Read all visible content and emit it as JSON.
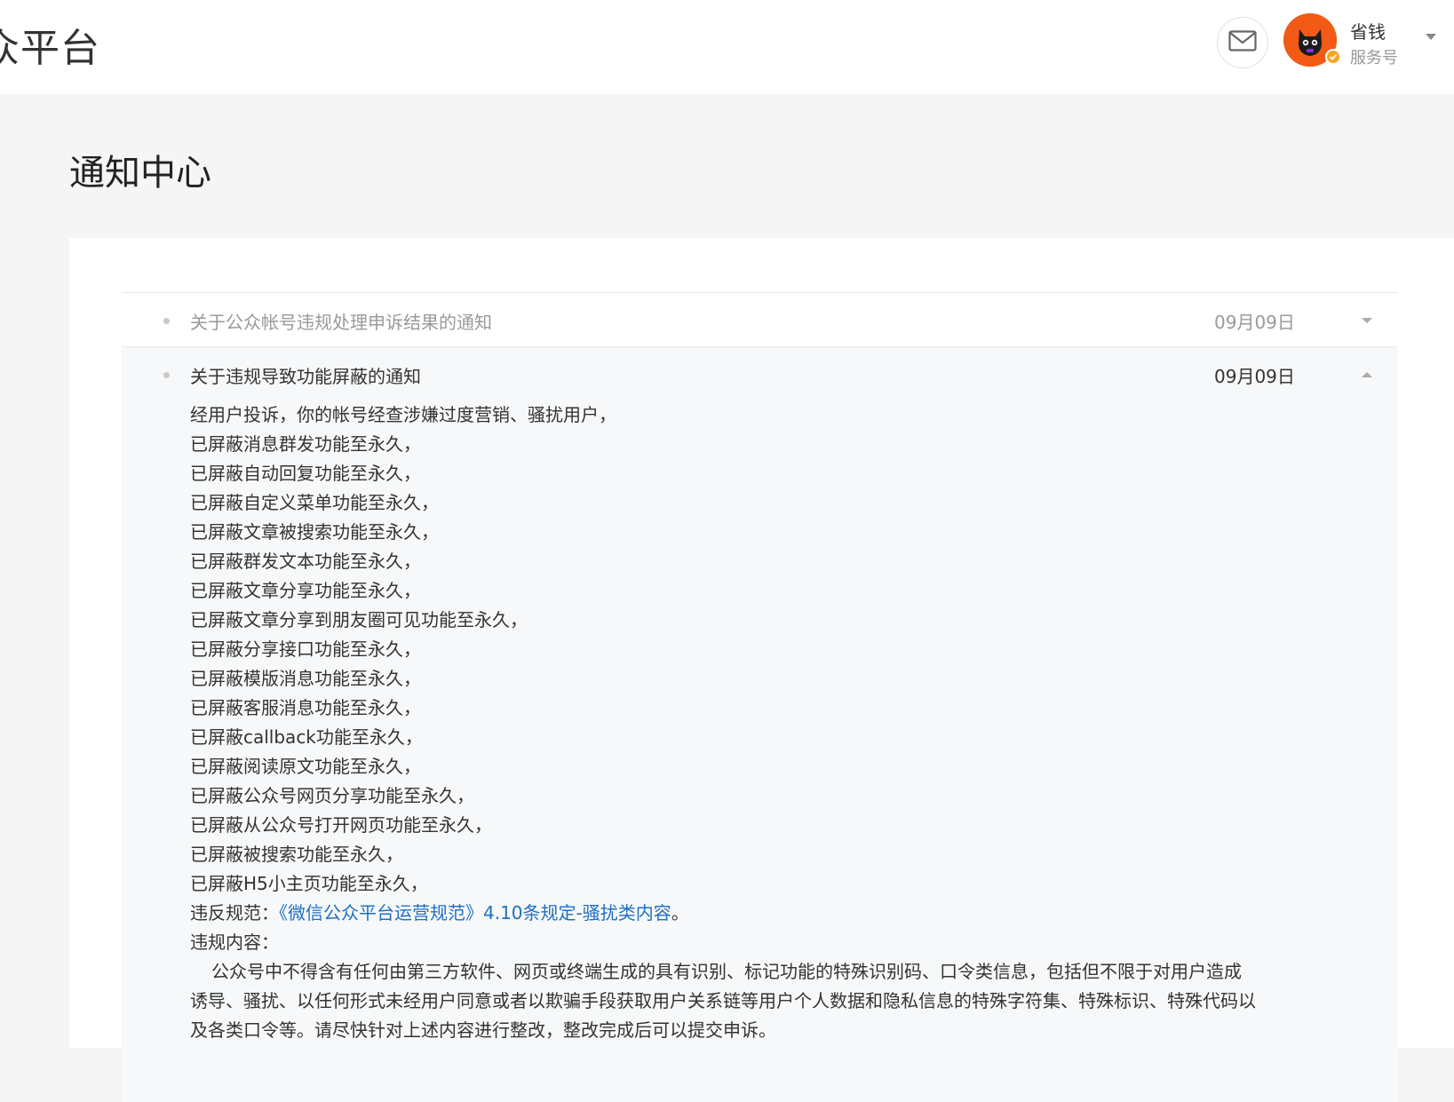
{
  "header": {
    "brand": "众平台",
    "account_name": "省钱",
    "account_type": "服务号",
    "accent": "#f25a16"
  },
  "page": {
    "title": "通知中心"
  },
  "notices": [
    {
      "title": "关于公众帐号违规处理申诉结果的通知",
      "date": "09月09日",
      "expanded": false
    },
    {
      "title": "关于违规导致功能屏蔽的通知",
      "date": "09月09日",
      "expanded": true,
      "body": {
        "lines": [
          "经用户投诉，你的帐号经查涉嫌过度营销、骚扰用户，",
          "已屏蔽消息群发功能至永久，",
          "已屏蔽自动回复功能至永久，",
          "已屏蔽自定义菜单功能至永久，",
          "已屏蔽文章被搜索功能至永久，",
          "已屏蔽群发文本功能至永久，",
          "已屏蔽文章分享功能至永久，",
          "已屏蔽文章分享到朋友圈可见功能至永久，",
          "已屏蔽分享接口功能至永久，",
          "已屏蔽模版消息功能至永久，",
          "已屏蔽客服消息功能至永久，",
          "已屏蔽callback功能至永久，",
          "已屏蔽阅读原文功能至永久，",
          "已屏蔽公众号网页分享功能至永久，",
          "已屏蔽从公众号打开网页功能至永久，",
          "已屏蔽被搜索功能至永久，",
          "已屏蔽H5小主页功能至永久，"
        ],
        "violation_label": "违反规范：",
        "violation_link": "《微信公众平台运营规范》4.10条规定-骚扰类内容",
        "violation_end": "。",
        "content_label": "违规内容：",
        "content_text": "公众号中不得含有任何由第三方软件、网页或终端生成的具有识别、标记功能的特殊识别码、口令类信息，包括但不限于对用户造成诱导、骚扰、以任何形式未经用户同意或者以欺骗手段获取用户关系链等用户个人数据和隐私信息的特殊字符集、特殊标识、特殊代码以及各类口令等。请尽快针对上述内容进行整改，整改完成后可以提交申诉。"
      }
    }
  ]
}
